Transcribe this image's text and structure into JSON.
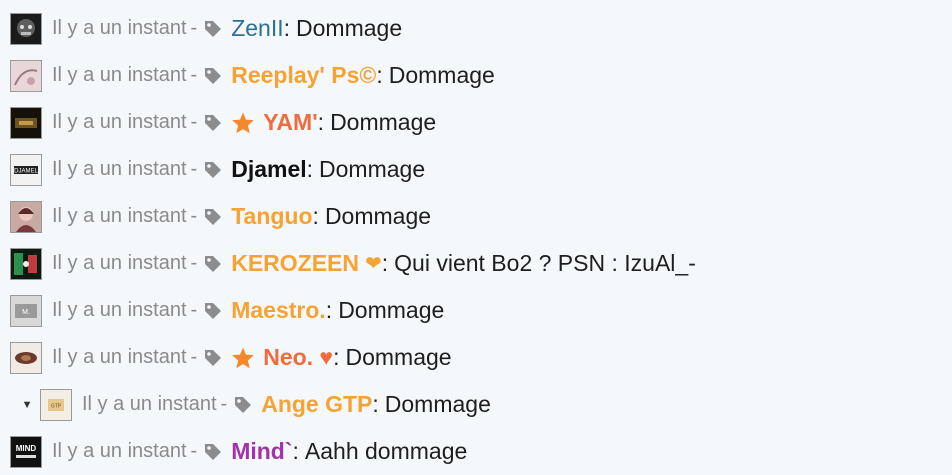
{
  "colors": {
    "orange": "#f7a233",
    "star_orange": "#f5872d",
    "red_user": "#f36a3d",
    "teal_user": "#2e6f96",
    "black_user": "#111111",
    "purple_user": "#a233a8"
  },
  "messages": [
    {
      "time": "Il y a un instant",
      "sep": "-",
      "user": "ZenII",
      "user_color": "#2e6f96",
      "user_weight": "plain",
      "star": false,
      "heart": "",
      "colon": ":",
      "text": "Dommage",
      "avatar": "dark-mask"
    },
    {
      "time": "Il y a un instant",
      "sep": "-",
      "user": "Reeplay' Ps©",
      "user_color": "#f7a233",
      "user_weight": "bold",
      "star": false,
      "heart": "",
      "colon": ":",
      "text": "Dommage",
      "avatar": "pink-sketch"
    },
    {
      "time": "Il y a un instant",
      "sep": "-",
      "user": "YAM'",
      "user_color": "#f36a3d",
      "user_weight": "bold",
      "star": true,
      "heart": "",
      "colon": ":",
      "text": "Dommage",
      "avatar": "dark-gold"
    },
    {
      "time": "Il y a un instant",
      "sep": "-",
      "user": "Djamel",
      "user_color": "#111111",
      "user_weight": "bold",
      "star": false,
      "heart": "",
      "colon": ":",
      "text": "Dommage",
      "avatar": "djamel-logo"
    },
    {
      "time": "Il y a un instant",
      "sep": "-",
      "user": "Tanguo",
      "user_color": "#f7a233",
      "user_weight": "bold",
      "star": false,
      "heart": "",
      "colon": ":",
      "text": "Dommage",
      "avatar": "girl-photo"
    },
    {
      "time": "Il y a un instant",
      "sep": "-",
      "user": "KEROZEEN",
      "user_color": "#f7a233",
      "user_weight": "bold",
      "star": false,
      "heart": "❤",
      "colon": ":",
      "text": "Qui vient Bo2 ? PSN : IzuAl_-",
      "avatar": "green-red"
    },
    {
      "time": "Il y a un instant",
      "sep": "-",
      "user": "Maestro.",
      "user_color": "#f7a233",
      "user_weight": "bold",
      "star": false,
      "heart": "",
      "colon": ":",
      "text": "Dommage",
      "avatar": "grey-logo"
    },
    {
      "time": "Il y a un instant",
      "sep": "-",
      "user": "Neo. ♥",
      "user_color": "#f36a3d",
      "user_weight": "bold",
      "star": true,
      "heart": "",
      "colon": ":",
      "text": "Dommage",
      "avatar": "brown-art"
    },
    {
      "time": "Il y a un instant",
      "sep": "-",
      "user": "Ange GTP",
      "user_color": "#f7a233",
      "user_weight": "bold",
      "star": false,
      "heart": "",
      "colon": ":",
      "text": "Dommage",
      "avatar": "beige-logo",
      "caret": true
    },
    {
      "time": "Il y a un instant",
      "sep": "-",
      "user": "Mind`",
      "user_color": "#a233a8",
      "user_weight": "bold",
      "star": false,
      "heart": "",
      "colon": ":",
      "text": "Aahh dommage",
      "avatar": "mind-logo"
    }
  ]
}
